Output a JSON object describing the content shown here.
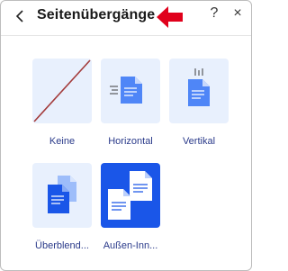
{
  "header": {
    "back_icon": "chevron-left-icon",
    "title": "Seitenübergänge",
    "help_label": "?",
    "close_label": "×"
  },
  "colors": {
    "accent": "#1a56e8",
    "tile_bg": "#e8f0fd",
    "page_blue": "#4f86f7",
    "label_color": "#2a3a8a",
    "pointer_arrow": "#e0001b",
    "none_slash": "#a33a3a"
  },
  "transitions": [
    {
      "label": "Keine",
      "icon": "no-transition-slash-icon",
      "selected": false
    },
    {
      "label": "Horizontal",
      "icon": "horizontal-transition-icon",
      "selected": false
    },
    {
      "label": "Vertikal",
      "icon": "vertical-transition-icon",
      "selected": false
    },
    {
      "label": "Überblend...",
      "icon": "crossfade-transition-icon",
      "selected": false
    },
    {
      "label": "Außen-Inn...",
      "icon": "outside-inside-transition-icon",
      "selected": true
    }
  ]
}
